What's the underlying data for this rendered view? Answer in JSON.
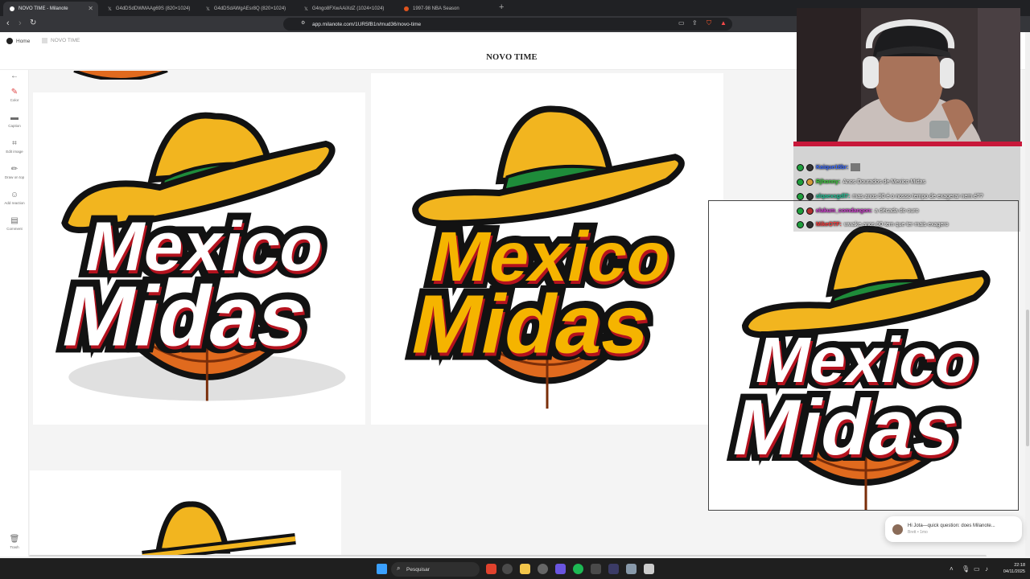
{
  "browser": {
    "tabs": [
      {
        "title": "NOVO TIME - Milanote",
        "icon": "milanote-icon"
      },
      {
        "title": "G4dDSdDWMAAg69S (820×1024)",
        "icon": "x-icon"
      },
      {
        "title": "G4dDSdAWgAEsr8Q (820×1024)",
        "icon": "x-icon"
      },
      {
        "title": "G4ngo8FXwAAiXdZ (1024×1024)",
        "icon": "x-icon"
      },
      {
        "title": "1997-98 NBA Season",
        "icon": "basketball-icon"
      }
    ],
    "url": "app.milanote.com/1UR5fB1n/mud36/novo-time"
  },
  "milanote": {
    "breadcrumb_home": "Home",
    "breadcrumb_board": "NOVO TIME",
    "board_title": "NOVO TIME",
    "tools": [
      {
        "label": "Color",
        "icon": "pen-icon"
      },
      {
        "label": "Caption",
        "icon": "caption-icon"
      },
      {
        "label": "Edit image",
        "icon": "crop-icon"
      },
      {
        "label": "Draw on top",
        "icon": "pencil-icon"
      },
      {
        "label": "Add reaction",
        "icon": "smile-icon"
      },
      {
        "label": "Comment",
        "icon": "comment-icon"
      }
    ],
    "trash_label": "Trash"
  },
  "logos": [
    {
      "line1": "Mexico",
      "line2": "Midas",
      "text_color": "#ffffff"
    },
    {
      "line1": "Mexico",
      "line2": "Midas",
      "text_color": "#f5b400"
    },
    {
      "line1": "Mexico",
      "line2": "Midas",
      "text_color": "#ffffff"
    }
  ],
  "colors": {
    "hat": "#f2b51f",
    "hat_band": "#1e8c3a",
    "outline": "#121212",
    "shadow_red": "#b4121e",
    "ball": "#e06a1e"
  },
  "chat": {
    "messages": [
      {
        "user": "Kaique18br:",
        "text": "",
        "user_color": "#3b6bff"
      },
      {
        "user": "Rjhonny:",
        "text": "Anos Dourados de Mexico Midas",
        "user_color": "#3ad13a"
      },
      {
        "user": "alqaexsgdl7:",
        "text": "mas anos 90 é o nosso tempo de exagerar nem é??",
        "user_color": "#22c79a"
      },
      {
        "user": "elakum_comdangon:",
        "text": "a década do ouro",
        "user_color": "#d23bd2"
      },
      {
        "user": "MikeOTF:",
        "text": "wwake anos 90 tem que ter mais exagero",
        "user_color": "#ff3a3a"
      }
    ]
  },
  "toast": {
    "text": "Hi Jota—quick question: does Milanote...",
    "meta": "Brett • 1mo"
  },
  "taskbar": {
    "search_placeholder": "Pesquisar",
    "time": "22:18",
    "date": "04/11/2025"
  }
}
